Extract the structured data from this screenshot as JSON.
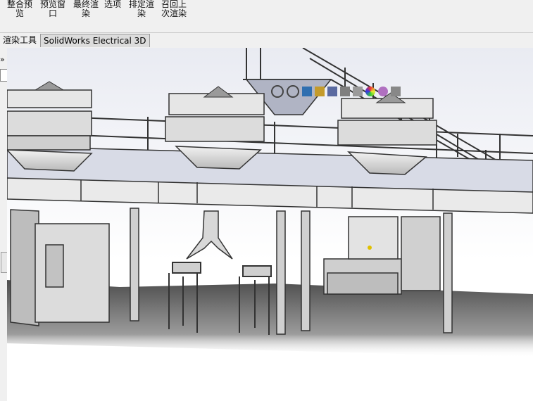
{
  "ribbon": {
    "buttons": [
      {
        "id": "integrated-preview",
        "line1": "整合预",
        "line2": "览"
      },
      {
        "id": "preview-window",
        "line1": "预览窗",
        "line2": "口"
      },
      {
        "id": "final-render",
        "line1": "最终渲",
        "line2": "染"
      },
      {
        "id": "options",
        "line1": "选项",
        "line2": ""
      },
      {
        "id": "schedule-render",
        "line1": "排定渲",
        "line2": "染"
      },
      {
        "id": "recall-last-render",
        "line1": "召回上",
        "line2": "次渲染"
      }
    ]
  },
  "tabs": [
    {
      "label": "渲染工具",
      "active": false
    },
    {
      "label": "SolidWorks Electrical 3D",
      "active": true
    }
  ],
  "leftpane": {
    "expand_glyph": "»"
  },
  "hud_icons": [
    "zoom-to-fit-icon",
    "zoom-to-area-icon",
    "previous-view-icon",
    "section-view-icon",
    "view-orientation-icon",
    "display-style-icon",
    "hide-show-items-icon",
    "edit-appearance-icon",
    "apply-scene-icon",
    "view-settings-icon"
  ],
  "colors": {
    "ribbon_bg": "#f0f0f0",
    "steel": "#d6d6d6",
    "steel_dark": "#5a5a5a",
    "floor_shadow": "#3a3a3a"
  }
}
